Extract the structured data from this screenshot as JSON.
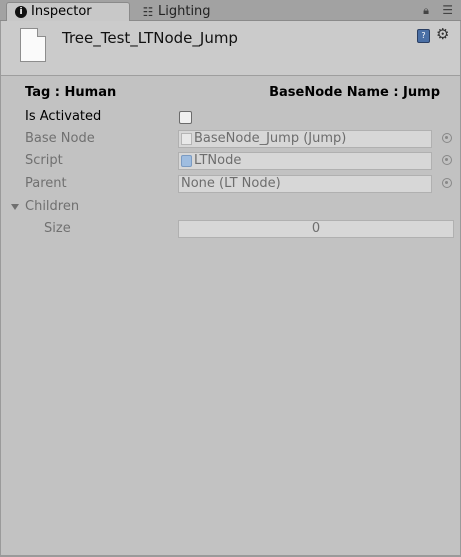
{
  "tabs": {
    "inspector": "Inspector",
    "lighting": "Lighting"
  },
  "header": {
    "title": "Tree_Test_LTNode_Jump"
  },
  "info": {
    "tag_label": "Tag :  Human",
    "basenode_label": "BaseNode Name : Jump"
  },
  "fields": {
    "is_activated": {
      "label": "Is Activated",
      "checked": false
    },
    "base_node": {
      "label": "Base Node",
      "value": "BaseNode_Jump (Jump)"
    },
    "script": {
      "label": "Script",
      "value": "LTNode"
    },
    "parent": {
      "label": "Parent",
      "value": "None (LT Node)"
    },
    "children": {
      "label": "Children",
      "expanded": true
    },
    "size": {
      "label": "Size",
      "value": "0"
    }
  },
  "icons": {
    "info": "info-icon",
    "lighting": "lighting-icon",
    "lock": "lock-icon",
    "menu": "menu-icon",
    "doc": "document-icon",
    "book": "book-icon",
    "gear": "gear-icon",
    "picker": "object-picker-icon"
  }
}
